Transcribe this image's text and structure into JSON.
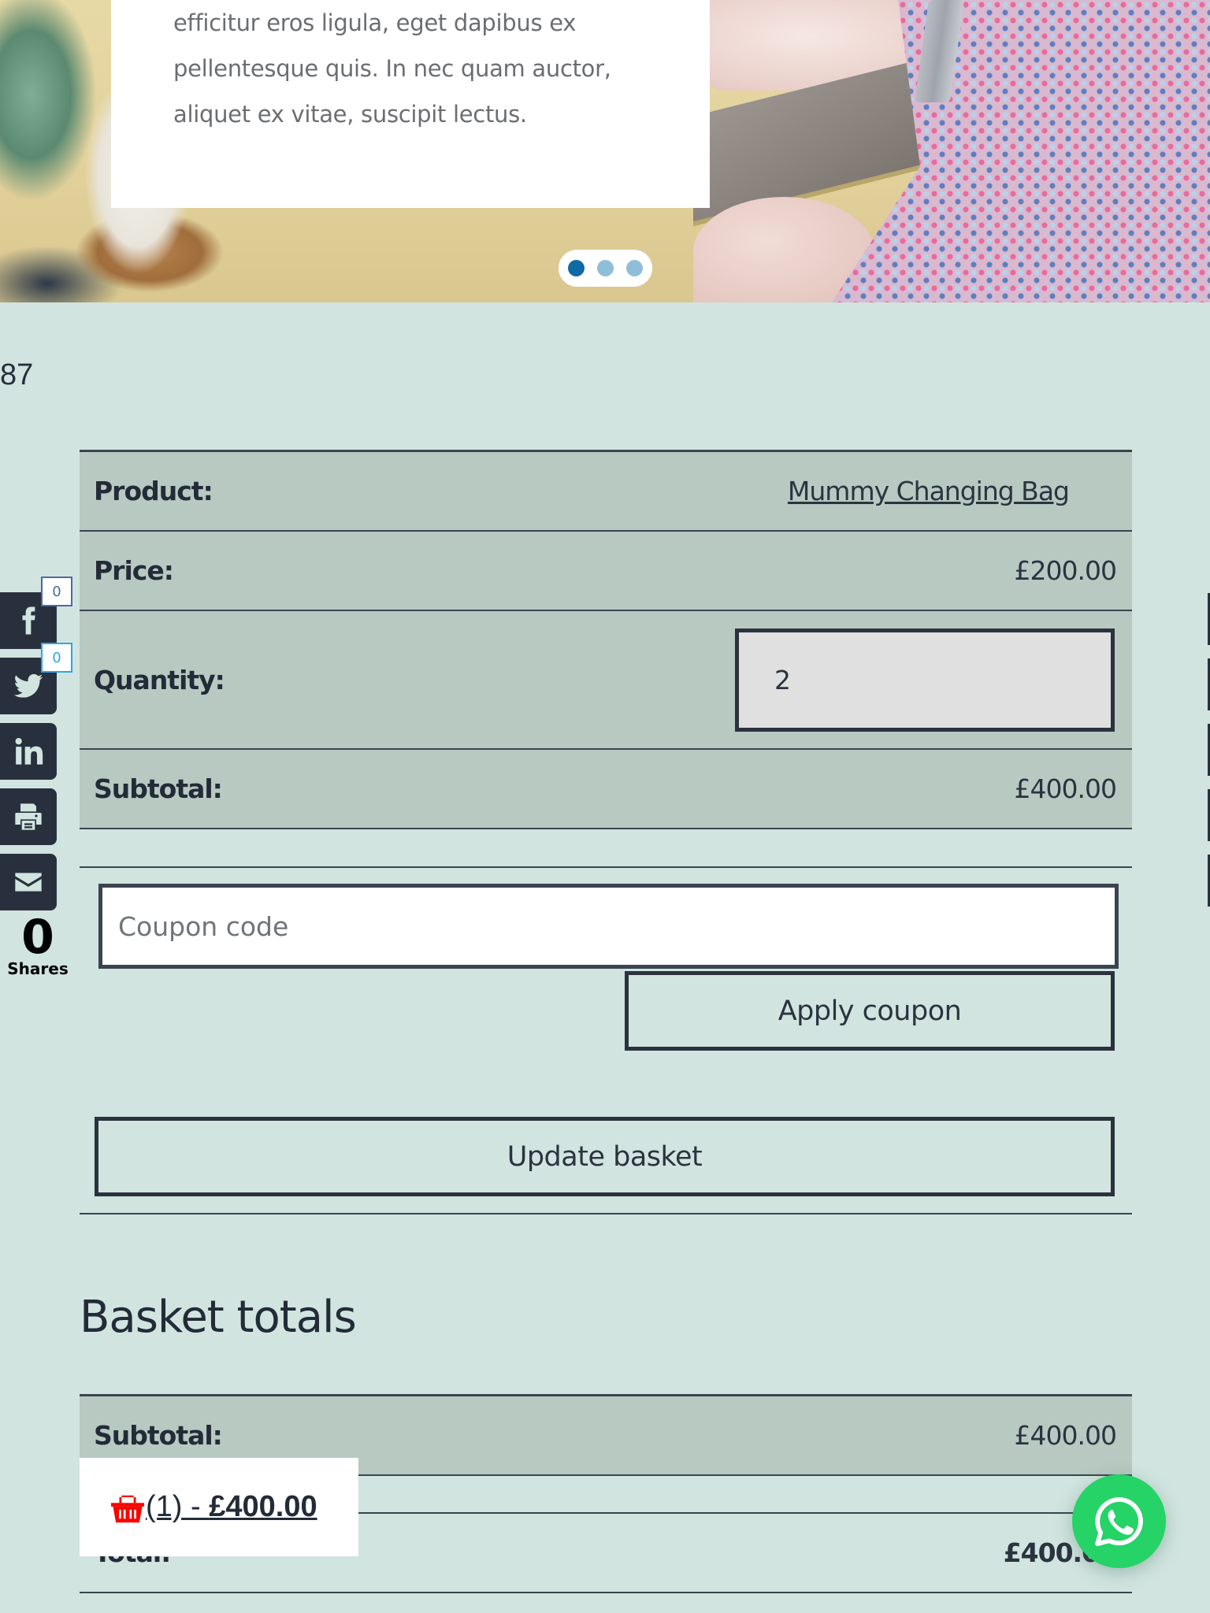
{
  "hero": {
    "card_text": "efficitur eros ligula, eget dapibus ex pellentesque quis. In nec quam auctor, aliquet ex vitae, suscipit lectus.",
    "carousel": {
      "slide_count": 3,
      "active_index": 0
    },
    "colors": {
      "dot_active": "#0f6aa6",
      "dot_inactive": "#8fbfd8"
    }
  },
  "counter_text": "87",
  "cart": {
    "rows": {
      "product": {
        "label": "Product:",
        "value": "Mummy Changing Bag"
      },
      "price": {
        "label": "Price:",
        "value": "£200.00"
      },
      "quantity": {
        "label": "Quantity:",
        "value": "2"
      },
      "subtotal": {
        "label": "Subtotal:",
        "value": "£400.00"
      }
    },
    "coupon": {
      "placeholder": "Coupon code",
      "value": ""
    },
    "apply_coupon_label": "Apply coupon",
    "update_basket_label": "Update basket"
  },
  "totals": {
    "title": "Basket totals",
    "subtotal": {
      "label": "Subtotal:",
      "value": "£400.00"
    },
    "total": {
      "label": "Total:",
      "value": "£400.00"
    }
  },
  "share": {
    "buttons": [
      {
        "network": "facebook",
        "icon": "facebook-icon",
        "count": "0"
      },
      {
        "network": "twitter",
        "icon": "twitter-icon",
        "count": "0"
      },
      {
        "network": "linkedin",
        "icon": "linkedin-icon"
      },
      {
        "network": "print",
        "icon": "printer-icon"
      },
      {
        "network": "email",
        "icon": "envelope-icon"
      }
    ],
    "total_count": "0",
    "total_label": "Shares"
  },
  "mini_cart": {
    "icon": "basket-icon",
    "count_text": "(1)",
    "separator": " - ",
    "amount": "£400.00",
    "icon_color": "#ff0000"
  },
  "whatsapp": {
    "icon": "whatsapp-icon",
    "color": "#25d366"
  },
  "colors": {
    "page_bg": "#d1e4df",
    "row_bg": "#b7c9c1",
    "text": "#272f3c",
    "share_bg": "#28303d"
  }
}
